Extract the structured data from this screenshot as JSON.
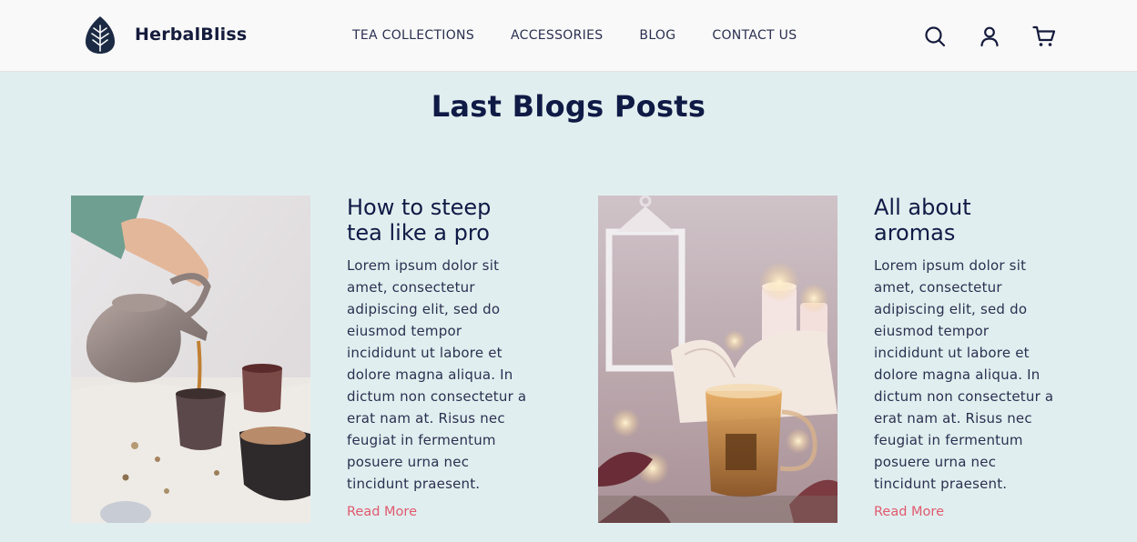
{
  "header": {
    "brand": "HerbalBliss",
    "nav": [
      "TEA COLLECTIONS",
      "ACCESSORIES",
      "BLOG",
      "CONTACT US"
    ],
    "icons": [
      "search-icon",
      "user-icon",
      "cart-icon"
    ]
  },
  "section": {
    "title": "Last Blogs Posts"
  },
  "posts": [
    {
      "title_line1": "How to steep",
      "title_line2": "tea like a pro",
      "body": "Lorem ipsum dolor sit amet, consectetur adipiscing elit, sed do eiusmod tempor incididunt ut labore et dolore magna aliqua. In dictum non consectetur a erat nam at. Risus nec feugiat in fermentum posuere urna nec tincidunt praesent.",
      "link": "Read More"
    },
    {
      "title_line1": "All about",
      "title_line2": "aromas",
      "body": "Lorem ipsum dolor sit amet, consectetur adipiscing elit, sed do eiusmod tempor incididunt ut labore et dolore magna aliqua. In dictum non consectetur a erat nam at. Risus nec feugiat in fermentum posuere urna nec tincidunt praesent.",
      "link": "Read More"
    }
  ],
  "colors": {
    "background": "#e1eeef",
    "header": "#f9f9f9",
    "heading": "#0f1a45",
    "link": "#e05a6f"
  }
}
